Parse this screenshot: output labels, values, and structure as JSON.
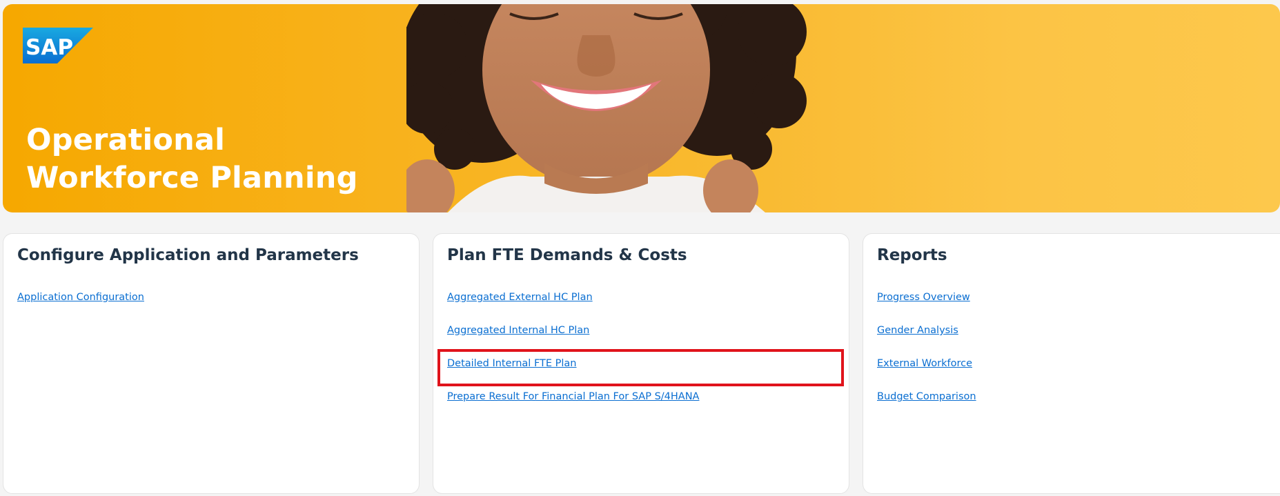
{
  "hero": {
    "logo_text": "SAP",
    "title_line1": "Operational",
    "title_line2": "Workforce Planning",
    "colors": {
      "banner_start": "#f6a800",
      "banner_end": "#fdc84c",
      "logo_blue": "#0a6ed1"
    }
  },
  "sections": [
    {
      "title": "Configure Application and Parameters",
      "links": [
        "Application Configuration"
      ]
    },
    {
      "title": "Plan FTE Demands & Costs",
      "links": [
        "Aggregated External HC Plan",
        "Aggregated Internal HC Plan",
        "Detailed Internal FTE Plan",
        "Prepare Result For Financial Plan For SAP S/4HANA"
      ]
    },
    {
      "title": "Reports",
      "links": [
        "Progress Overview",
        "Gender Analysis",
        "External Workforce",
        "Budget Comparison"
      ]
    }
  ],
  "highlight": {
    "target": "Detailed Internal FTE Plan",
    "color": "#e0131b"
  },
  "colors": {
    "link": "#0a6ed1",
    "heading": "#223548",
    "background": "#f4f4f4"
  }
}
